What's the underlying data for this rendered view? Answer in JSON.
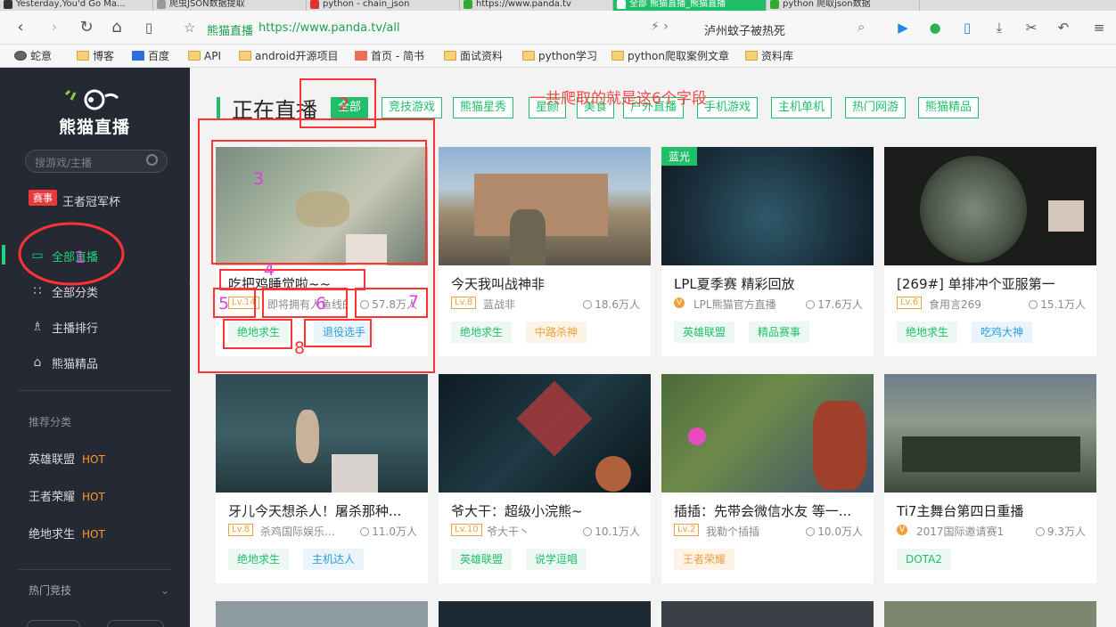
{
  "browser": {
    "tabs": [
      {
        "label": "Yesterday,You'd Go Ma..."
      },
      {
        "label": "爬虫JSON数据提取"
      },
      {
        "label": "python - chain_json"
      },
      {
        "label": "https://www.panda.tv"
      },
      {
        "label": "全部 熊猫直播_熊猫直播"
      },
      {
        "label": "python 爬取json数据"
      }
    ],
    "site_name": "熊猫直播",
    "url": "https://www.panda.tv/all",
    "hot_search": "泸州蚊子被热死",
    "bookmarks": [
      "蛇意",
      "博客",
      "百度",
      "API",
      "android开源项目",
      "首页 - 简书",
      "面试资料",
      "python学习",
      "python爬取案例文章",
      "资料库"
    ]
  },
  "sidebar": {
    "logo_text": "熊猫直播",
    "search_placeholder": "搜游戏/主播",
    "event_badge": "赛事",
    "event_label": "王者冠军杯",
    "nav": [
      {
        "label": "全部直播"
      },
      {
        "label": "全部分类"
      },
      {
        "label": "主播排行"
      },
      {
        "label": "熊猫精品"
      }
    ],
    "rec_header": "推荐分类",
    "categories": [
      {
        "label": "英雄联盟",
        "hot": "HOT"
      },
      {
        "label": "王者荣耀",
        "hot": "HOT"
      },
      {
        "label": "绝地求生",
        "hot": "HOT"
      }
    ],
    "more": "热门竞技"
  },
  "main": {
    "title": "正在直播",
    "filters": [
      "全部",
      "竞技游戏",
      "熊猫星秀",
      "星颜",
      "美食",
      "户外直播",
      "手机游戏",
      "主机单机",
      "热门网游",
      "熊猫精品"
    ],
    "annotation": "一共爬取的就是这6个字段",
    "cards": [
      {
        "title": "吃把鸡睡觉啦~~",
        "level": "Lv.14",
        "host": "即将拥有人鱼线的...",
        "views": "57.8万人",
        "tags": [
          "绝地求生",
          "退役选手"
        ],
        "badge": ""
      },
      {
        "title": "今天我叫战神非",
        "level": "Lv.8",
        "host": "蓝战非",
        "views": "18.6万人",
        "tags": [
          "绝地求生",
          "中路杀神"
        ],
        "badge": ""
      },
      {
        "title": "LPL夏季赛 精彩回放",
        "level": "V",
        "host": "LPL熊猫官方直播",
        "views": "17.6万人",
        "tags": [
          "英雄联盟",
          "精品赛事"
        ],
        "badge": "蓝光"
      },
      {
        "title": "[269#] 单排冲个亚服第一",
        "level": "Lv.6",
        "host": "食用言269",
        "views": "15.1万人",
        "tags": [
          "绝地求生",
          "吃鸡大神"
        ],
        "badge": ""
      },
      {
        "title": "牙儿今天想杀人！屠杀那种...",
        "level": "Lv.8",
        "host": "杀鸡国际娱乐...",
        "views": "11.0万人",
        "tags": [
          "绝地求生",
          "主机达人"
        ],
        "badge": ""
      },
      {
        "title": "爷大干：超级小浣熊~",
        "level": "Lv.10",
        "host": "爷大干丶",
        "views": "10.1万人",
        "tags": [
          "英雄联盟",
          "说学逗唱"
        ],
        "badge": ""
      },
      {
        "title": "插插：先带会微信水友 等一...",
        "level": "Lv.2",
        "host": "我勒个插插",
        "views": "10.0万人",
        "tags": [
          "王者荣耀"
        ],
        "badge": ""
      },
      {
        "title": "Ti7主舞台第四日重播",
        "level": "V",
        "host": "2017国际邀请赛1",
        "views": "9.3万人",
        "tags": [
          "DOTA2"
        ],
        "badge": ""
      }
    ],
    "markers": [
      "1",
      "2",
      "3",
      "4",
      "5",
      "6",
      "7",
      "8"
    ]
  },
  "colors": {
    "accent": "#1fbf6a",
    "sidebar": "#252933",
    "annotation": "#ff3333",
    "marker": "#e040e0"
  }
}
